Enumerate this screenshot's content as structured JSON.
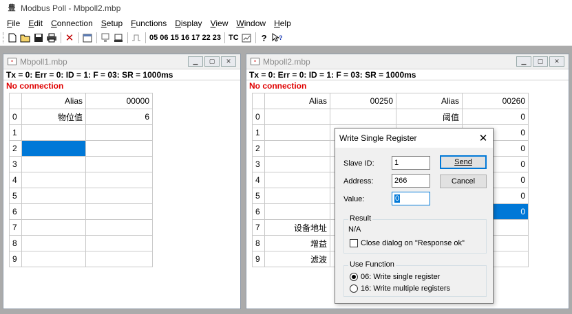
{
  "app": {
    "title": "Modbus Poll - Mbpoll2.mbp",
    "icon_glyph": "豊"
  },
  "menu": [
    "File",
    "Edit",
    "Connection",
    "Setup",
    "Functions",
    "Display",
    "View",
    "Window",
    "Help"
  ],
  "toolbar": {
    "function_codes": "05 06 15 16 17 22 23",
    "tc_label": "TC"
  },
  "window1": {
    "title": "Mbpoll1.mbp",
    "status": "Tx = 0: Err = 0: ID = 1: F = 03: SR = 1000ms",
    "connection": "No connection",
    "headers": {
      "alias": "Alias",
      "address": "00000"
    },
    "rows": [
      {
        "n": "0",
        "alias": "物位值",
        "value": "6"
      },
      {
        "n": "1",
        "alias": "",
        "value": ""
      },
      {
        "n": "2",
        "alias": "",
        "value": ""
      },
      {
        "n": "3",
        "alias": "",
        "value": ""
      },
      {
        "n": "4",
        "alias": "",
        "value": ""
      },
      {
        "n": "5",
        "alias": "",
        "value": ""
      },
      {
        "n": "6",
        "alias": "",
        "value": ""
      },
      {
        "n": "7",
        "alias": "",
        "value": ""
      },
      {
        "n": "8",
        "alias": "",
        "value": ""
      },
      {
        "n": "9",
        "alias": "",
        "value": ""
      }
    ]
  },
  "window2": {
    "title": "Mbpoll2.mbp",
    "status": "Tx = 0: Err = 0: ID = 1: F = 03: SR = 1000ms",
    "connection": "No connection",
    "headers": {
      "alias1": "Alias",
      "address1": "00250",
      "alias2": "Alias",
      "address2": "00260"
    },
    "rows": [
      {
        "n": "0",
        "alias1": "",
        "v1": "",
        "alias2": "阈值",
        "v2": "0"
      },
      {
        "n": "1",
        "alias1": "",
        "v1": "",
        "alias2": "",
        "v2": "0"
      },
      {
        "n": "2",
        "alias1": "",
        "v1": "",
        "alias2": "",
        "v2": "0"
      },
      {
        "n": "3",
        "alias1": "",
        "v1": "",
        "alias2": "",
        "v2": "0"
      },
      {
        "n": "4",
        "alias1": "",
        "v1": "",
        "alias2": "",
        "v2": "0"
      },
      {
        "n": "5",
        "alias1": "",
        "v1": "",
        "alias2": "",
        "v2": "0"
      },
      {
        "n": "6",
        "alias1": "",
        "v1": "",
        "alias2": "",
        "v2": "0"
      },
      {
        "n": "7",
        "alias1": "设备地址",
        "v1": "",
        "alias2": "",
        "v2": ""
      },
      {
        "n": "8",
        "alias1": "增益",
        "v1": "",
        "alias2": "",
        "v2": ""
      },
      {
        "n": "9",
        "alias1": "滤波",
        "v1": "",
        "alias2": "",
        "v2": ""
      }
    ]
  },
  "dialog": {
    "title": "Write Single Register",
    "close_glyph": "✕",
    "slave_id_label": "Slave ID:",
    "slave_id_value": "1",
    "address_label": "Address:",
    "address_value": "266",
    "value_label": "Value:",
    "value_value": "0",
    "send_label": "Send",
    "cancel_label": "Cancel",
    "result_legend": "Result",
    "result_text": "N/A",
    "close_on_ok_label": "Close dialog on \"Response ok\"",
    "use_function_legend": "Use Function",
    "fn06_label": "06: Write single register",
    "fn16_label": "16: Write multiple registers",
    "fn_selected": "06"
  },
  "colors": {
    "selection": "#0078d7",
    "no_connection": "#e00000"
  }
}
